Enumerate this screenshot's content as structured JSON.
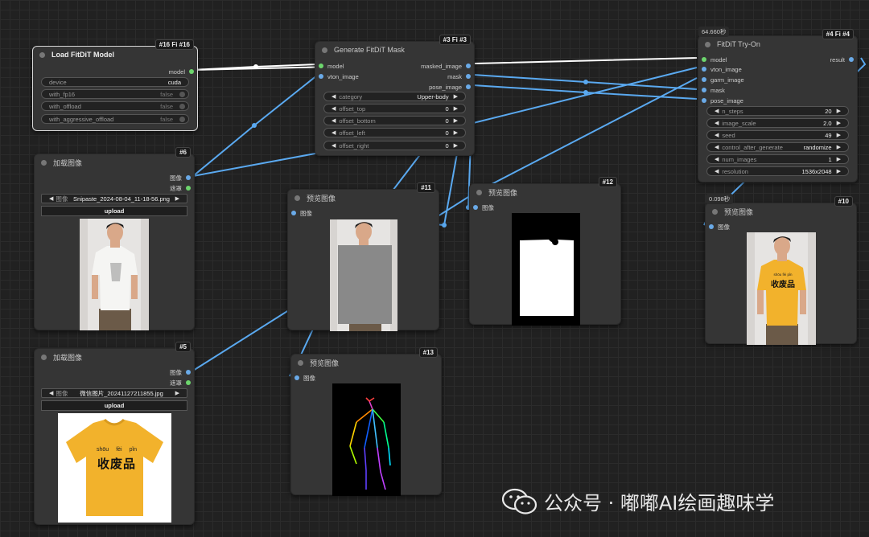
{
  "nodes": {
    "load_model": {
      "id": "#16 Fi #16",
      "title": "Load FitDiT Model",
      "output": "model",
      "widgets": [
        {
          "label": "device",
          "value": "cuda"
        },
        {
          "label": "with_fp16",
          "value": "false"
        },
        {
          "label": "with_offload",
          "value": "false"
        },
        {
          "label": "with_aggressive_offload",
          "value": "false"
        }
      ]
    },
    "load_image_6": {
      "id": "#6",
      "title": "加载图像",
      "outputs": [
        "图像",
        "遮罩"
      ],
      "file_label": "图像",
      "file_value": "Snipaste_2024-08-04_11-18-56.png",
      "upload": "upload"
    },
    "load_image_5": {
      "id": "#5",
      "title": "加载图像",
      "outputs": [
        "图像",
        "遮罩"
      ],
      "file_label": "图像",
      "file_value": "微信图片_20241127211855.jpg",
      "upload": "upload",
      "shirt_text_pinyin": [
        "shōu",
        "fèi",
        "pǐn"
      ],
      "shirt_text": "收废品"
    },
    "mask": {
      "id": "#3 Fi #3",
      "title": "Generate FitDiT Mask",
      "inputs": [
        "model",
        "vton_image"
      ],
      "outputs": [
        "masked_image",
        "mask",
        "pose_image"
      ],
      "widgets": [
        {
          "label": "category",
          "value": "Upper-body"
        },
        {
          "label": "offset_top",
          "value": "0"
        },
        {
          "label": "offset_bottom",
          "value": "0"
        },
        {
          "label": "offset_left",
          "value": "0"
        },
        {
          "label": "offset_right",
          "value": "0"
        }
      ]
    },
    "tryon": {
      "id": "#4 Fi #4",
      "time": "64.660秒",
      "title": "FitDiT Try-On",
      "inputs": [
        "model",
        "vton_image",
        "garm_image",
        "mask",
        "pose_image"
      ],
      "output": "result",
      "widgets": [
        {
          "label": "n_steps",
          "value": "20"
        },
        {
          "label": "image_scale",
          "value": "2.0"
        },
        {
          "label": "seed",
          "value": "49"
        },
        {
          "label": "control_after_generate",
          "value": "randomize"
        },
        {
          "label": "num_images",
          "value": "1"
        },
        {
          "label": "resolution",
          "value": "1536x2048"
        }
      ]
    },
    "preview_11": {
      "id": "#11",
      "title": "预览图像",
      "input": "图像"
    },
    "preview_12": {
      "id": "#12",
      "title": "预览图像",
      "input": "图像"
    },
    "preview_13": {
      "id": "#13",
      "title": "预览图像",
      "input": "图像"
    },
    "preview_10": {
      "id": "#10",
      "time": "0.098秒",
      "title": "预览图像",
      "input": "图像",
      "shirt_text_pinyin": "shōu fèi pǐn",
      "shirt_text": "收废品"
    }
  },
  "watermark": "公众号 · 嘟嘟AI绘画趣味学",
  "colors": {
    "canvas": "#212121",
    "node": "#353535",
    "wire_image": "#5aa9f0",
    "wire_model": "#ffffff",
    "port_green": "#6dd66d",
    "shirt_yellow": "#f2b22c"
  }
}
